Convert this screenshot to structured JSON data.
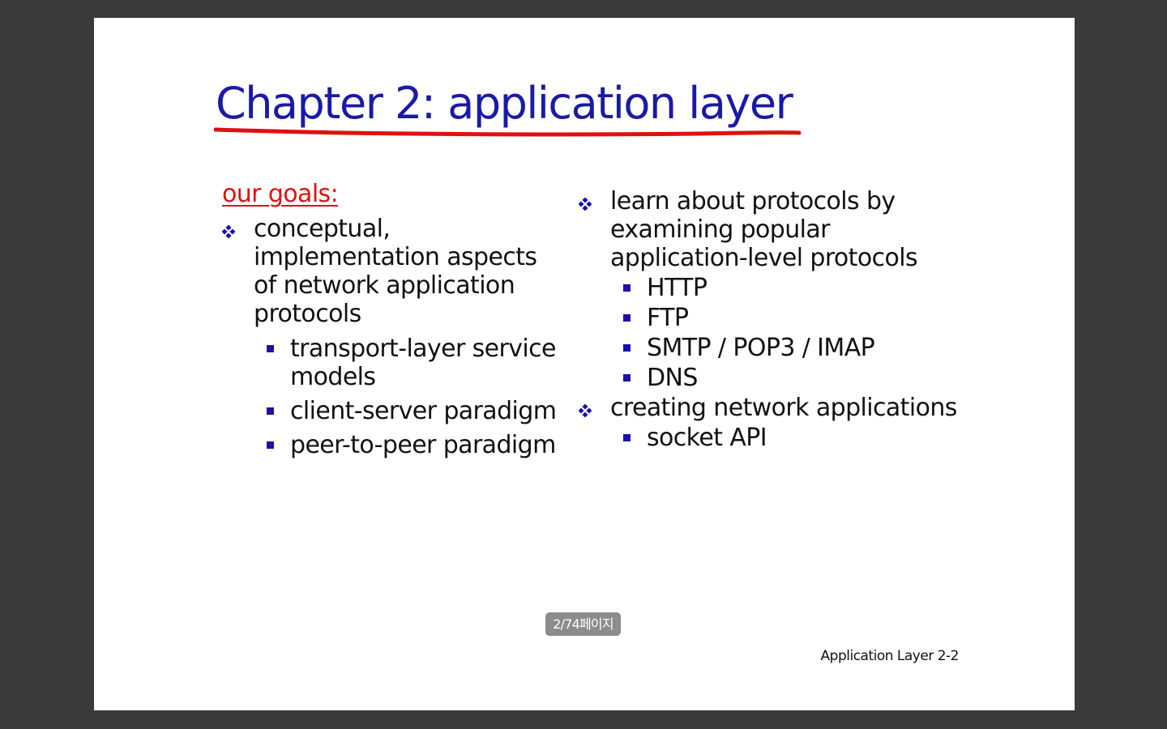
{
  "slide": {
    "title": "Chapter 2: application layer",
    "goals_heading": "our goals:",
    "left_bullets": [
      {
        "text": "conceptual, implementation aspects of network application protocols",
        "sub": [
          "transport-layer service models",
          "client-server paradigm",
          "peer-to-peer paradigm"
        ]
      }
    ],
    "right_bullets": [
      {
        "text": "learn about protocols by examining popular application-level protocols",
        "sub": [
          "HTTP",
          "FTP",
          "SMTP / POP3 / IMAP",
          "DNS"
        ]
      },
      {
        "text": "creating network applications",
        "sub": [
          "socket API"
        ]
      }
    ],
    "footer": "Application Layer 2-2"
  },
  "viewer": {
    "page_indicator": "2/74페이지"
  },
  "colors": {
    "title": "#1a1aa6",
    "underline": "#e01010",
    "bullet": "#1c10a8",
    "background": "#3a3a3a"
  },
  "icons": {
    "level1_bullet": "diamond-cluster-icon",
    "level2_bullet": "square-bullet-icon"
  }
}
